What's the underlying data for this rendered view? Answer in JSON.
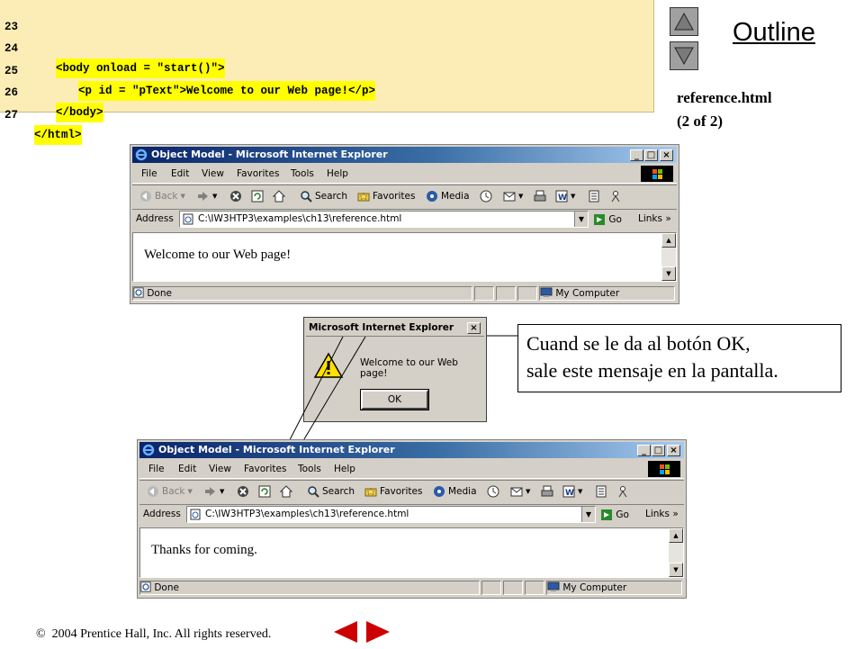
{
  "code": {
    "lines": [
      {
        "num": "23",
        "text": ""
      },
      {
        "num": "24",
        "text": "<body onload = \"start()\">"
      },
      {
        "num": "25",
        "text": "<p id = \"pText\">Welcome to our Web page!</p>"
      },
      {
        "num": "26",
        "text": "</body>"
      },
      {
        "num": "27",
        "text": "</html>"
      }
    ]
  },
  "outline": {
    "title": "Outline",
    "file_name": "reference.html",
    "page_info": "(2 of 2)"
  },
  "window1": {
    "title": "Object Model - Microsoft Internet Explorer",
    "menu": [
      "File",
      "Edit",
      "View",
      "Favorites",
      "Tools",
      "Help"
    ],
    "toolbar": {
      "back": "Back",
      "search": "Search",
      "favorites": "Favorites",
      "media": "Media"
    },
    "address_label": "Address",
    "address": "C:\\IW3HTP3\\examples\\ch13\\reference.html",
    "go": "Go",
    "links": "Links",
    "links_more": "»",
    "page_text": "Welcome to our Web page!",
    "status": "Done",
    "zone": "My Computer"
  },
  "dialog": {
    "title": "Microsoft Internet Explorer",
    "message": "Welcome to our Web page!",
    "ok": "OK"
  },
  "callout": {
    "line1": "Cuand se le da al botón OK,",
    "line2": "sale este mensaje en la pantalla."
  },
  "window2": {
    "title": "Object Model - Microsoft Internet Explorer",
    "menu": [
      "File",
      "Edit",
      "View",
      "Favorites",
      "Tools",
      "Help"
    ],
    "toolbar": {
      "back": "Back",
      "search": "Search",
      "favorites": "Favorites",
      "media": "Media"
    },
    "address_label": "Address",
    "address": "C:\\IW3HTP3\\examples\\ch13\\reference.html",
    "go": "Go",
    "links": "Links",
    "links_more": "»",
    "page_text": "Thanks for coming.",
    "status": "Done",
    "zone": "My Computer"
  },
  "footer": {
    "copyright_symbol": "©",
    "copyright": "2004 Prentice Hall, Inc.  All rights reserved."
  },
  "colors": {
    "code_bg": "#fcedb7",
    "highlight": "#ffff00",
    "nav_arrows": "#cc0000"
  }
}
